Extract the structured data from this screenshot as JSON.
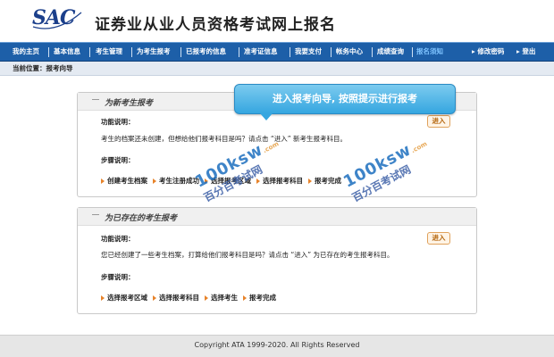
{
  "header": {
    "logo_text": "SAC",
    "site_title": "证券业从业人员资格考试网上报名"
  },
  "nav": {
    "items": [
      {
        "label": "我的主页"
      },
      {
        "label": "基本信息"
      },
      {
        "label": "考生管理"
      },
      {
        "label": "为考生报考"
      },
      {
        "label": "已报考的信息"
      },
      {
        "label": "准考证信息"
      },
      {
        "label": "我要支付"
      },
      {
        "label": "帐务中心"
      },
      {
        "label": "成绩查询"
      },
      {
        "label": "报名须知"
      }
    ],
    "change_password": "修改密码",
    "logout": "登出"
  },
  "breadcrumb": {
    "text": "当前位置：报考向导"
  },
  "tooltip": {
    "text": "进入报考向导, 按照提示进行报考"
  },
  "panel_new": {
    "title": "为新考生报考",
    "func_label": "功能说明：",
    "func_desc": "考生的档案还未创建，但想给他们报考科目是吗？请点击 “进入” 新考生报考科目。",
    "steps_label": "步骤说明：",
    "steps": [
      "创建考生档案",
      "考生注册成功",
      "选择报考区域",
      "选择报考科目",
      "报考完成"
    ],
    "enter_label": "进入"
  },
  "panel_existing": {
    "title": "为已存在的考生报考",
    "func_label": "功能说明：",
    "func_desc": "您已经创建了一些考生档案，打算给他们报考科目是吗？请点击 “进入” 为已存在的考生报考科目。",
    "steps_label": "步骤说明：",
    "steps": [
      "选择报考区域",
      "选择报考科目",
      "选择考生",
      "报考完成"
    ],
    "enter_label": "进入"
  },
  "watermark": {
    "site": "100ksw",
    "domain": ".com",
    "name": "百分百考试网"
  },
  "footer": {
    "copyright": "Copyright ATA 1999-2020. All Rights Reserved"
  }
}
